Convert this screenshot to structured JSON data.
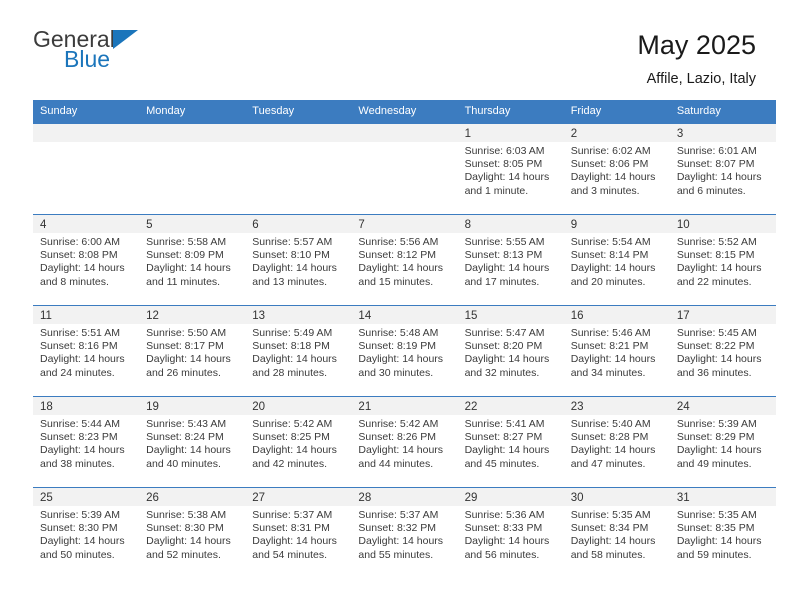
{
  "brand": {
    "name_top": "General",
    "name_bottom": "Blue",
    "triangle_color": "#1b75bb"
  },
  "header": {
    "title": "May 2025",
    "subtitle": "Affile, Lazio, Italy"
  },
  "theme": {
    "header_blue": "#3c7cc0",
    "daynum_bg": "#f2f2f2",
    "text": "#333333"
  },
  "labels": {
    "sunrise_prefix": "Sunrise:",
    "sunset_prefix": "Sunset:",
    "daylight_prefix": "Daylight:"
  },
  "weekdays": [
    "Sunday",
    "Monday",
    "Tuesday",
    "Wednesday",
    "Thursday",
    "Friday",
    "Saturday"
  ],
  "weeks": [
    [
      {
        "empty": true
      },
      {
        "empty": true
      },
      {
        "empty": true
      },
      {
        "empty": true
      },
      {
        "day": "1",
        "sunrise": "Sunrise: 6:03 AM",
        "sunset": "Sunset: 8:05 PM",
        "daylight": "Daylight: 14 hours and 1 minute."
      },
      {
        "day": "2",
        "sunrise": "Sunrise: 6:02 AM",
        "sunset": "Sunset: 8:06 PM",
        "daylight": "Daylight: 14 hours and 3 minutes."
      },
      {
        "day": "3",
        "sunrise": "Sunrise: 6:01 AM",
        "sunset": "Sunset: 8:07 PM",
        "daylight": "Daylight: 14 hours and 6 minutes."
      }
    ],
    [
      {
        "day": "4",
        "sunrise": "Sunrise: 6:00 AM",
        "sunset": "Sunset: 8:08 PM",
        "daylight": "Daylight: 14 hours and 8 minutes."
      },
      {
        "day": "5",
        "sunrise": "Sunrise: 5:58 AM",
        "sunset": "Sunset: 8:09 PM",
        "daylight": "Daylight: 14 hours and 11 minutes."
      },
      {
        "day": "6",
        "sunrise": "Sunrise: 5:57 AM",
        "sunset": "Sunset: 8:10 PM",
        "daylight": "Daylight: 14 hours and 13 minutes."
      },
      {
        "day": "7",
        "sunrise": "Sunrise: 5:56 AM",
        "sunset": "Sunset: 8:12 PM",
        "daylight": "Daylight: 14 hours and 15 minutes."
      },
      {
        "day": "8",
        "sunrise": "Sunrise: 5:55 AM",
        "sunset": "Sunset: 8:13 PM",
        "daylight": "Daylight: 14 hours and 17 minutes."
      },
      {
        "day": "9",
        "sunrise": "Sunrise: 5:54 AM",
        "sunset": "Sunset: 8:14 PM",
        "daylight": "Daylight: 14 hours and 20 minutes."
      },
      {
        "day": "10",
        "sunrise": "Sunrise: 5:52 AM",
        "sunset": "Sunset: 8:15 PM",
        "daylight": "Daylight: 14 hours and 22 minutes."
      }
    ],
    [
      {
        "day": "11",
        "sunrise": "Sunrise: 5:51 AM",
        "sunset": "Sunset: 8:16 PM",
        "daylight": "Daylight: 14 hours and 24 minutes."
      },
      {
        "day": "12",
        "sunrise": "Sunrise: 5:50 AM",
        "sunset": "Sunset: 8:17 PM",
        "daylight": "Daylight: 14 hours and 26 minutes."
      },
      {
        "day": "13",
        "sunrise": "Sunrise: 5:49 AM",
        "sunset": "Sunset: 8:18 PM",
        "daylight": "Daylight: 14 hours and 28 minutes."
      },
      {
        "day": "14",
        "sunrise": "Sunrise: 5:48 AM",
        "sunset": "Sunset: 8:19 PM",
        "daylight": "Daylight: 14 hours and 30 minutes."
      },
      {
        "day": "15",
        "sunrise": "Sunrise: 5:47 AM",
        "sunset": "Sunset: 8:20 PM",
        "daylight": "Daylight: 14 hours and 32 minutes."
      },
      {
        "day": "16",
        "sunrise": "Sunrise: 5:46 AM",
        "sunset": "Sunset: 8:21 PM",
        "daylight": "Daylight: 14 hours and 34 minutes."
      },
      {
        "day": "17",
        "sunrise": "Sunrise: 5:45 AM",
        "sunset": "Sunset: 8:22 PM",
        "daylight": "Daylight: 14 hours and 36 minutes."
      }
    ],
    [
      {
        "day": "18",
        "sunrise": "Sunrise: 5:44 AM",
        "sunset": "Sunset: 8:23 PM",
        "daylight": "Daylight: 14 hours and 38 minutes."
      },
      {
        "day": "19",
        "sunrise": "Sunrise: 5:43 AM",
        "sunset": "Sunset: 8:24 PM",
        "daylight": "Daylight: 14 hours and 40 minutes."
      },
      {
        "day": "20",
        "sunrise": "Sunrise: 5:42 AM",
        "sunset": "Sunset: 8:25 PM",
        "daylight": "Daylight: 14 hours and 42 minutes."
      },
      {
        "day": "21",
        "sunrise": "Sunrise: 5:42 AM",
        "sunset": "Sunset: 8:26 PM",
        "daylight": "Daylight: 14 hours and 44 minutes."
      },
      {
        "day": "22",
        "sunrise": "Sunrise: 5:41 AM",
        "sunset": "Sunset: 8:27 PM",
        "daylight": "Daylight: 14 hours and 45 minutes."
      },
      {
        "day": "23",
        "sunrise": "Sunrise: 5:40 AM",
        "sunset": "Sunset: 8:28 PM",
        "daylight": "Daylight: 14 hours and 47 minutes."
      },
      {
        "day": "24",
        "sunrise": "Sunrise: 5:39 AM",
        "sunset": "Sunset: 8:29 PM",
        "daylight": "Daylight: 14 hours and 49 minutes."
      }
    ],
    [
      {
        "day": "25",
        "sunrise": "Sunrise: 5:39 AM",
        "sunset": "Sunset: 8:30 PM",
        "daylight": "Daylight: 14 hours and 50 minutes."
      },
      {
        "day": "26",
        "sunrise": "Sunrise: 5:38 AM",
        "sunset": "Sunset: 8:30 PM",
        "daylight": "Daylight: 14 hours and 52 minutes."
      },
      {
        "day": "27",
        "sunrise": "Sunrise: 5:37 AM",
        "sunset": "Sunset: 8:31 PM",
        "daylight": "Daylight: 14 hours and 54 minutes."
      },
      {
        "day": "28",
        "sunrise": "Sunrise: 5:37 AM",
        "sunset": "Sunset: 8:32 PM",
        "daylight": "Daylight: 14 hours and 55 minutes."
      },
      {
        "day": "29",
        "sunrise": "Sunrise: 5:36 AM",
        "sunset": "Sunset: 8:33 PM",
        "daylight": "Daylight: 14 hours and 56 minutes."
      },
      {
        "day": "30",
        "sunrise": "Sunrise: 5:35 AM",
        "sunset": "Sunset: 8:34 PM",
        "daylight": "Daylight: 14 hours and 58 minutes."
      },
      {
        "day": "31",
        "sunrise": "Sunrise: 5:35 AM",
        "sunset": "Sunset: 8:35 PM",
        "daylight": "Daylight: 14 hours and 59 minutes."
      }
    ]
  ]
}
